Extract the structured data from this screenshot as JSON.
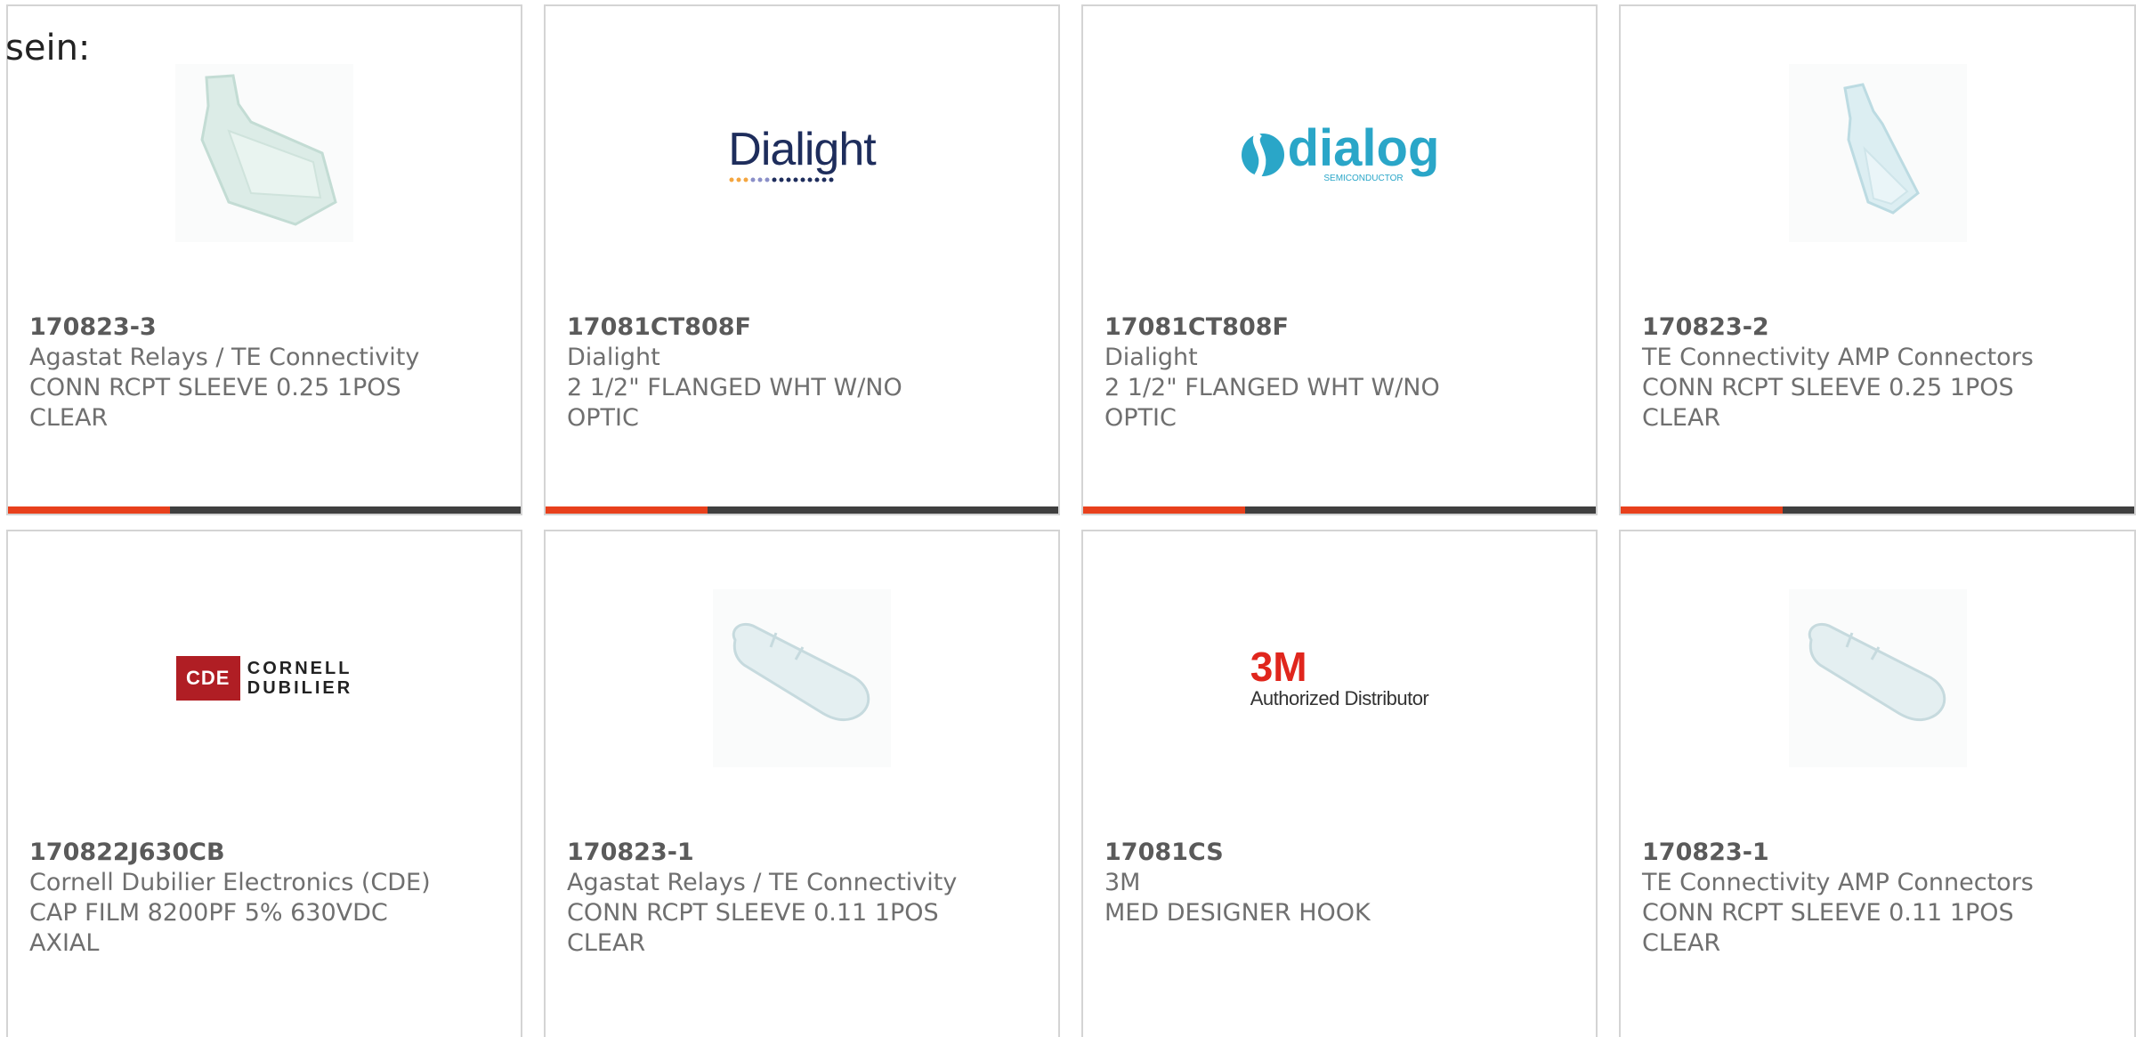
{
  "intro_text": "sein:",
  "accent_color": "#e8401c",
  "bar_color": "#3f3f3f",
  "cards": [
    {
      "part_number": "170823-3",
      "manufacturer": "Agastat Relays / TE Connectivity",
      "description_line1": "CONN RCPT SLEEVE 0.25 1POS",
      "description_line2": "CLEAR",
      "image": "clear-sleeve-wide"
    },
    {
      "part_number": "17081CT808F",
      "manufacturer": "Dialight",
      "description_line1": "2 1/2\" FLANGED WHT W/NO",
      "description_line2": "OPTIC",
      "image": "dialight-logo",
      "logo_text": "Dialight"
    },
    {
      "part_number": "17081CT808F",
      "manufacturer": "Dialight",
      "description_line1": "2 1/2\" FLANGED WHT W/NO",
      "description_line2": "OPTIC",
      "image": "dialog-logo",
      "logo_text": "dialog",
      "logo_sub": "SEMICONDUCTOR"
    },
    {
      "part_number": "170823-2",
      "manufacturer": "TE Connectivity AMP Connectors",
      "description_line1": "CONN RCPT SLEEVE 0.25 1POS",
      "description_line2": "CLEAR",
      "image": "clear-sleeve-narrow"
    },
    {
      "part_number": "170822J630CB",
      "manufacturer": "Cornell Dubilier Electronics (CDE)",
      "description_line1": "CAP FILM 8200PF 5% 630VDC",
      "description_line2": "AXIAL",
      "image": "cde-logo",
      "logo_badge": "CDE",
      "logo_line1": "CORNELL",
      "logo_line2": "DUBILIER"
    },
    {
      "part_number": "170823-1",
      "manufacturer": "Agastat Relays / TE Connectivity",
      "description_line1": "CONN RCPT SLEEVE 0.11 1POS",
      "description_line2": "CLEAR",
      "image": "clear-sleeve-long"
    },
    {
      "part_number": "17081CS",
      "manufacturer": "3M",
      "description_line1": "MED DESIGNER HOOK",
      "description_line2": "",
      "image": "3m-logo",
      "logo_text": "3M",
      "logo_sub": "Authorized Distributor"
    },
    {
      "part_number": "170823-1",
      "manufacturer": "TE Connectivity AMP Connectors",
      "description_line1": "CONN RCPT SLEEVE 0.11 1POS",
      "description_line2": "CLEAR",
      "image": "clear-sleeve-long"
    }
  ]
}
